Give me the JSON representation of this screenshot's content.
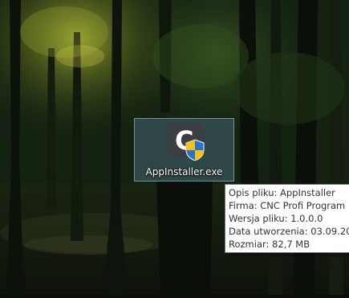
{
  "desktop": {
    "icon_name": "AppInstaller.exe",
    "icon_semantic": "app-installer-shield-icon",
    "tooltip": {
      "lines": [
        "Opis pliku: AppInstaller",
        "Firma: CNC Profi Program",
        "Wersja pliku: 1.0.0.0",
        "Data utworzenia: 03.09.20",
        "Rozmiar: 82,7 MB"
      ]
    }
  },
  "colors": {
    "tooltip_bg": "#ffffff",
    "tooltip_border": "#767676",
    "selection": "#78aad2",
    "shield_blue": "#2b6fcf",
    "shield_yellow": "#f2c21a"
  }
}
